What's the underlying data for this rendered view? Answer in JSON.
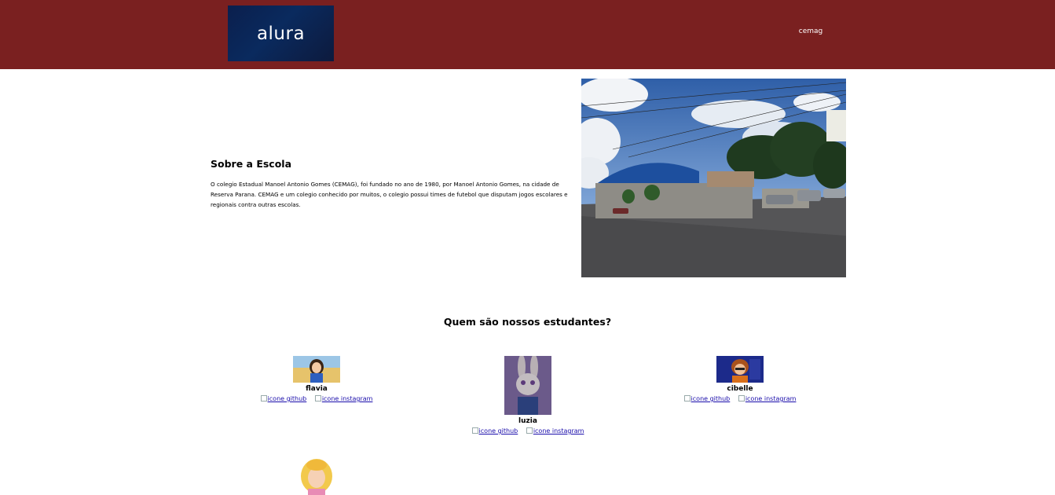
{
  "header": {
    "logo_text": "alura",
    "nav": [
      {
        "label": "cemag"
      }
    ]
  },
  "about": {
    "title": "Sobre a Escola",
    "text": "O colegio Estadual Manoel Antonio Gomes (CEMAG), foi fundado no ano de 1980, por Manoel Antonio Gomes, na cidade de Reserva Parana. CEMAG e um colegio conhecido por muitos, o colegio possui times de futebol que disputam jogos escolares e regionais contra outras escolas."
  },
  "students_section": {
    "title": "Quem são nossos estudantes?",
    "students": [
      {
        "name": "flavia",
        "github_alt": "icone github",
        "instagram_alt": "icone instagram"
      },
      {
        "name": "luzia",
        "github_alt": "icone github",
        "instagram_alt": "icone instagram"
      },
      {
        "name": "cibelle",
        "github_alt": "icone github",
        "instagram_alt": "icone instagram"
      },
      {
        "name": "",
        "github_alt": "",
        "instagram_alt": ""
      }
    ]
  },
  "colors": {
    "header_bg": "#7a2020",
    "logo_bg": "#0b1f4d",
    "link": "#1a0dab"
  }
}
